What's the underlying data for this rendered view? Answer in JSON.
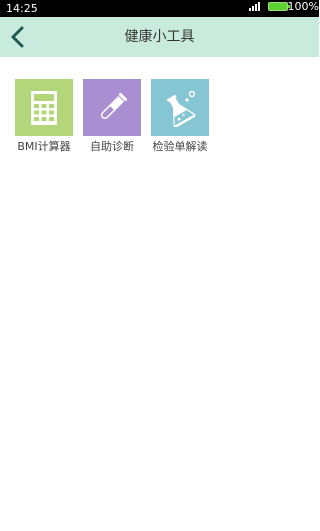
{
  "status_bar": {
    "time": "14:25",
    "battery": "100%"
  },
  "header": {
    "title": "健康小工具",
    "back_icon": "chevron-left-icon",
    "background": "#c9ebde"
  },
  "tools": [
    {
      "label": "BMI计算器",
      "icon": "calculator-icon",
      "color": "#b4d67a"
    },
    {
      "label": "自助诊断",
      "icon": "test-tube-icon",
      "color": "#a98ed2"
    },
    {
      "label": "检验单解读",
      "icon": "flask-icon",
      "color": "#86c5d4"
    }
  ]
}
